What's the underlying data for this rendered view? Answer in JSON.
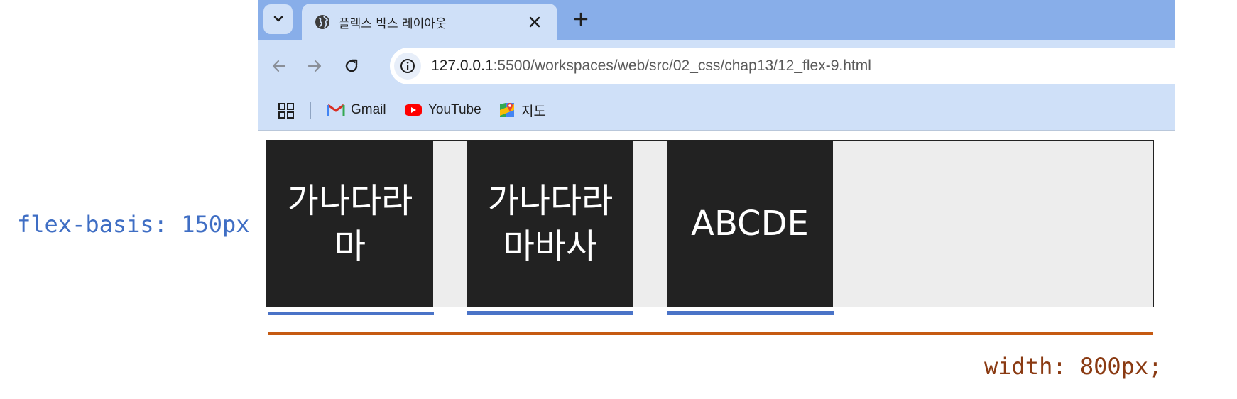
{
  "browser": {
    "tab": {
      "title": "플렉스 박스 레이아웃",
      "favicon": "globe-icon"
    },
    "omnibox": {
      "url_host": "127.0.0.1",
      "url_rest": ":5500/workspaces/web/src/02_css/chap13/12_flex-9.html"
    },
    "bookmarks": [
      {
        "label": "Gmail",
        "icon": "gmail-icon"
      },
      {
        "label": "YouTube",
        "icon": "youtube-icon"
      },
      {
        "label": "지도",
        "icon": "maps-icon"
      }
    ],
    "colors": {
      "tabstrip": "#88aee9",
      "toolbar": "#cfe0f8"
    }
  },
  "demo": {
    "items": [
      "가나다라마",
      "가나다라마바사",
      "ABCDE"
    ],
    "annotations": {
      "flex_basis": "flex-basis: 150px",
      "width": "width: 800px;"
    },
    "colors": {
      "item_bg": "#222222",
      "container_bg": "#ededed",
      "basis_line": "#4a73c7",
      "width_line": "#c55a12"
    }
  }
}
